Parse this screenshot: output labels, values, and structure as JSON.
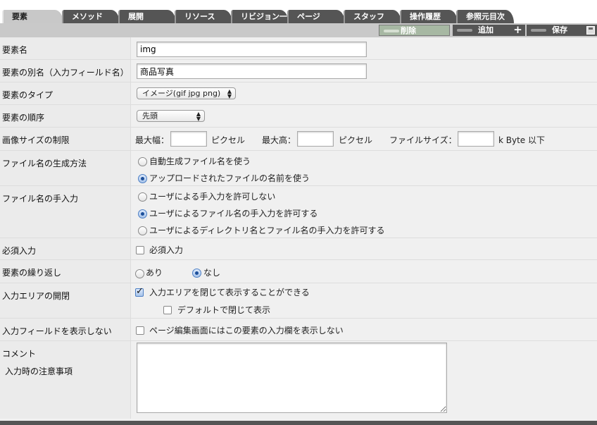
{
  "tabs": [
    {
      "label": "要素",
      "active": true
    },
    {
      "label": "メソッド"
    },
    {
      "label": "展開"
    },
    {
      "label": "リソース"
    },
    {
      "label": "リビジョン一覧"
    },
    {
      "label": "ページ"
    },
    {
      "label": "スタッフ"
    },
    {
      "label": "操作履歴"
    },
    {
      "label": "参照元目次"
    }
  ],
  "toolbar": {
    "delete_label": "削除",
    "add_label": "追加",
    "save_label": "保存"
  },
  "form": {
    "element_name": {
      "label": "要素名",
      "value": "img"
    },
    "element_alias": {
      "label": "要素の別名（入力フィールド名）",
      "value": "商品写真"
    },
    "element_type": {
      "label": "要素のタイプ",
      "selected": "イメージ(gif jpg png)"
    },
    "element_order": {
      "label": "要素の順序",
      "selected": "先頭"
    },
    "image_size": {
      "label": "画像サイズの制限",
      "max_width_label": "最大幅：",
      "max_height_label": "最大高：",
      "pixel_unit": "ピクセル",
      "file_size_label": "ファイルサイズ：",
      "file_size_unit": "k Byte 以下",
      "max_width": "",
      "max_height": "",
      "file_size": ""
    },
    "filename_method": {
      "label": "ファイル名の生成方法",
      "options": [
        "自動生成ファイル名を使う",
        "アップロードされたファイルの名前を使う"
      ],
      "selected_index": 1
    },
    "filename_manual": {
      "label": "ファイル名の手入力",
      "options": [
        "ユーザによる手入力を許可しない",
        "ユーザによるファイル名の手入力を許可する",
        "ユーザによるディレクトリ名とファイル名の手入力を許可する"
      ],
      "selected_index": 1
    },
    "required": {
      "label": "必須入力",
      "checkbox_label": "必須入力",
      "checked": false
    },
    "repeat": {
      "label": "要素の繰り返し",
      "yes_label": "あり",
      "no_label": "なし",
      "selected": "なし"
    },
    "collapse": {
      "label": "入力エリアの開閉",
      "collapsible_label": "入力エリアを閉じて表示することができる",
      "collapsible_checked": true,
      "default_closed_label": "デフォルトで閉じて表示",
      "default_closed_checked": false
    },
    "hide_field": {
      "label": "入力フィールドを表示しない",
      "checkbox_label": "ページ編集画面にはこの要素の入力欄を表示しない",
      "checked": false
    },
    "comment": {
      "label": "コメント",
      "sub_label": "入力時の注意事項",
      "value": ""
    }
  },
  "colors": {
    "tab_bg": "#555555",
    "tab_active_bg": "#c8c8c8",
    "delete_bg": "#a7b8a3",
    "radio_dot": "#1c4f9a"
  }
}
